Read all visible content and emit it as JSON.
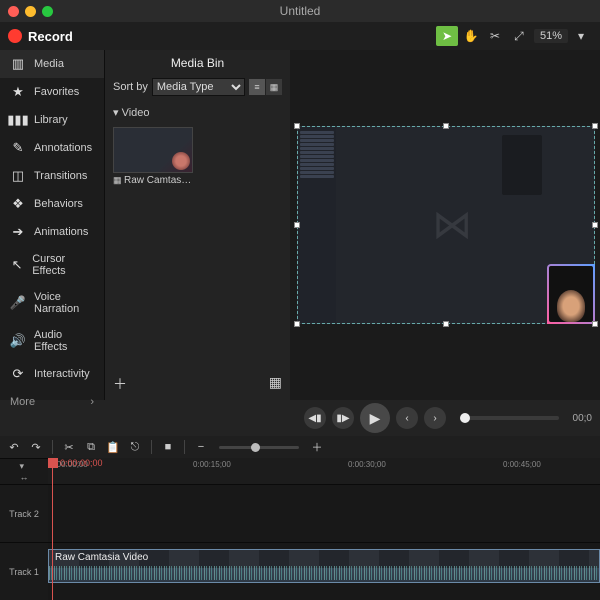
{
  "window": {
    "title": "Untitled"
  },
  "toolbar": {
    "record_label": "Record",
    "zoom_value": "51%"
  },
  "sidebar": {
    "items": [
      {
        "label": "Media"
      },
      {
        "label": "Favorites"
      },
      {
        "label": "Library"
      },
      {
        "label": "Annotations"
      },
      {
        "label": "Transitions"
      },
      {
        "label": "Behaviors"
      },
      {
        "label": "Animations"
      },
      {
        "label": "Cursor Effects"
      },
      {
        "label": "Voice Narration"
      },
      {
        "label": "Audio Effects"
      },
      {
        "label": "Interactivity"
      }
    ],
    "more_label": "More"
  },
  "mediabin": {
    "title": "Media Bin",
    "sort_label": "Sort by",
    "sort_value": "Media Type",
    "category": "Video",
    "items": [
      {
        "label": "Raw Camtasia V…"
      }
    ]
  },
  "playbar": {
    "current_time": "00;0"
  },
  "timeline": {
    "playhead_time": "0:00:00;00",
    "ruler": [
      "0:00:00;00",
      "0:00:15;00",
      "0:00:30;00",
      "0:00:45;00"
    ],
    "tracks": [
      {
        "name": "Track 2"
      },
      {
        "name": "Track 1"
      }
    ],
    "clip_label": "Raw Camtasia Video"
  }
}
